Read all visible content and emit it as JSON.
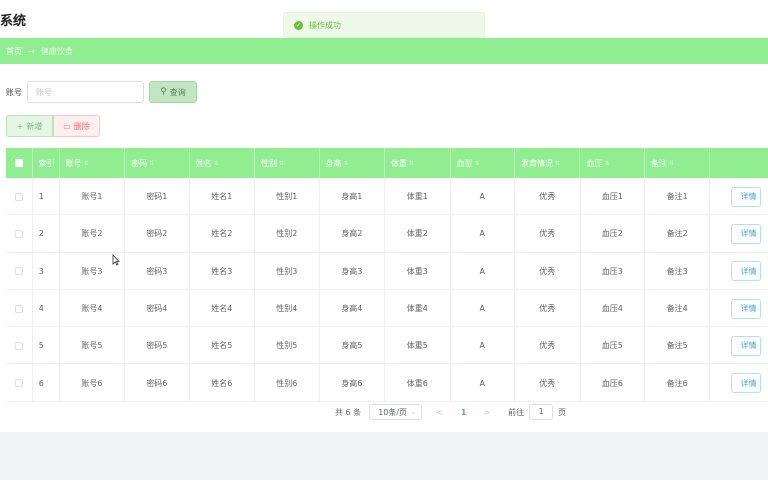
{
  "app": {
    "title": "系统"
  },
  "toast": {
    "message": "操作成功"
  },
  "breadcrumb": {
    "home": "首页",
    "separator": "→",
    "current": "健康饮食"
  },
  "search": {
    "label": "账号",
    "placeholder": "账号",
    "button": "查询"
  },
  "actions": {
    "add": "新增",
    "delete": "删除"
  },
  "table": {
    "columns": [
      "索引",
      "账号",
      "密码",
      "姓名",
      "性别",
      "身高",
      "体重",
      "血型",
      "发育情况",
      "血压",
      "备注"
    ],
    "rows": [
      {
        "index": "1",
        "account": "账号1",
        "password": "密码1",
        "name": "姓名1",
        "gender": "性别1",
        "height": "身高1",
        "weight": "体重1",
        "blood_type": "A",
        "development": "优秀",
        "blood_pressure": "血压1",
        "note": "备注1",
        "detail": "详情"
      },
      {
        "index": "2",
        "account": "账号2",
        "password": "密码2",
        "name": "姓名2",
        "gender": "性别2",
        "height": "身高2",
        "weight": "体重2",
        "blood_type": "A",
        "development": "优秀",
        "blood_pressure": "血压2",
        "note": "备注2",
        "detail": "详情"
      },
      {
        "index": "3",
        "account": "账号3",
        "password": "密码3",
        "name": "姓名3",
        "gender": "性别3",
        "height": "身高3",
        "weight": "体重3",
        "blood_type": "A",
        "development": "优秀",
        "blood_pressure": "血压3",
        "note": "备注3",
        "detail": "详情"
      },
      {
        "index": "4",
        "account": "账号4",
        "password": "密码4",
        "name": "姓名4",
        "gender": "性别4",
        "height": "身高4",
        "weight": "体重4",
        "blood_type": "A",
        "development": "优秀",
        "blood_pressure": "血压4",
        "note": "备注4",
        "detail": "详情"
      },
      {
        "index": "5",
        "account": "账号5",
        "password": "密码5",
        "name": "姓名5",
        "gender": "性别5",
        "height": "身高5",
        "weight": "体重5",
        "blood_type": "A",
        "development": "优秀",
        "blood_pressure": "血压5",
        "note": "备注5",
        "detail": "详情"
      },
      {
        "index": "6",
        "account": "账号6",
        "password": "密码6",
        "name": "姓名6",
        "gender": "性别6",
        "height": "身高6",
        "weight": "体重6",
        "blood_type": "A",
        "development": "优秀",
        "blood_pressure": "血压6",
        "note": "备注6",
        "detail": "详情"
      }
    ]
  },
  "pagination": {
    "total": "共 6 条",
    "page_size": "10条/页",
    "current_page": "1",
    "goto_label": "前往",
    "goto_value": "1",
    "page_unit": "页"
  },
  "colors": {
    "accent": "#90ee90",
    "success": "#67c23a",
    "danger": "#f56c6c",
    "link": "#3ea6d6"
  },
  "icons": {
    "toast": "check-circle-icon",
    "search": "search-icon",
    "add": "plus-icon",
    "delete": "trash-icon",
    "prev": "chevron-left-icon",
    "next": "chevron-right-icon",
    "page_size": "chevron-down-icon"
  }
}
